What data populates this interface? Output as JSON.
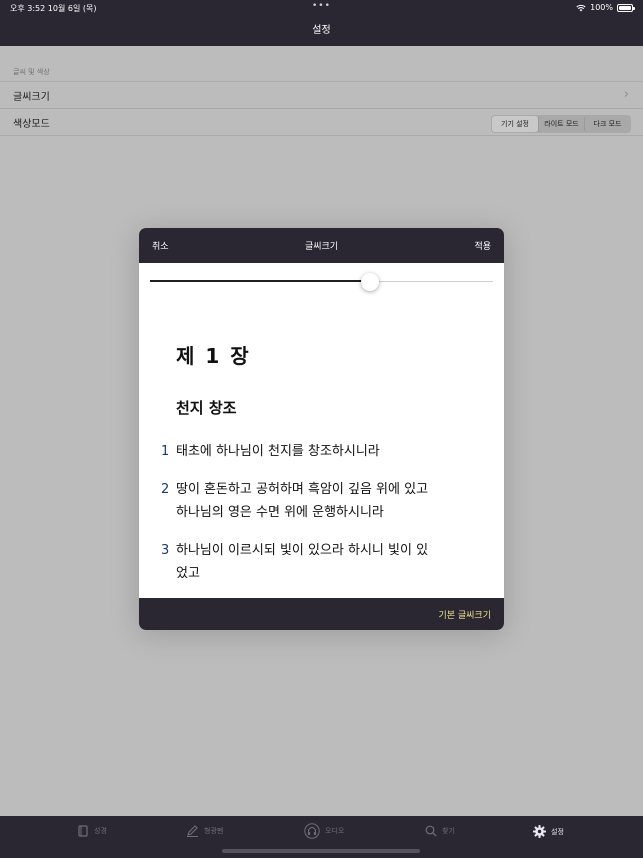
{
  "status_bar": {
    "time_date": "오후 3:52   10월 6일 (목)",
    "dots": "•••",
    "battery": "100%"
  },
  "nav": {
    "title": "설정"
  },
  "settings": {
    "section_header": "글씨 및 색상",
    "font_size_row": {
      "label": "글씨크기"
    },
    "color_mode_row": {
      "label": "색상모드",
      "options": [
        "기기 설정",
        "라이트 모드",
        "다크 모드"
      ],
      "selected": "기기 설정"
    }
  },
  "modal": {
    "cancel": "취소",
    "title": "글씨크기",
    "apply": "적용",
    "slider": {
      "value": 0.64
    },
    "preview": {
      "chapter": "제 1 장",
      "heading": "천지 창조",
      "verses": [
        {
          "num": "1",
          "text": "태초에 하나님이 천지를 창조하시니라"
        },
        {
          "num": "2",
          "line1": "땅이 혼돈하고 공허하며 흑암이 깊음 위에 있고",
          "line2": "하나님의 영은 수면 위에 운행하시니라"
        },
        {
          "num": "3",
          "line1": "하나님이 이르시되 빛이 있으라 하시니 빛이 있",
          "line2": "었고"
        }
      ]
    },
    "default_button": "기본 글씨크기"
  },
  "tabbar": {
    "tabs": [
      {
        "label": "성경",
        "icon": "book-icon",
        "active": false
      },
      {
        "label": "형광펜",
        "icon": "pen-icon",
        "active": false
      },
      {
        "label": "오디오",
        "icon": "headphones-icon",
        "active": false
      },
      {
        "label": "찾기",
        "icon": "search-icon",
        "active": false
      },
      {
        "label": "설정",
        "icon": "gear-icon",
        "active": true
      }
    ]
  },
  "colors": {
    "bar": "#2a2733",
    "background_dimmed": "#bcbcbc",
    "accent_footer_text": "#f2e38a",
    "verse_number": "#1b3a6b"
  }
}
